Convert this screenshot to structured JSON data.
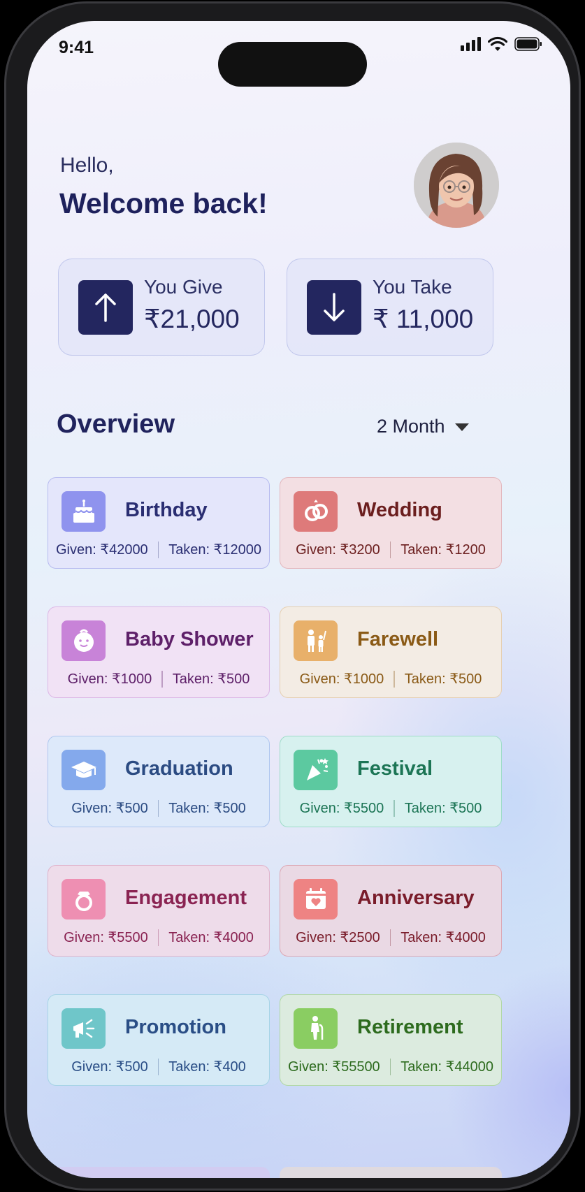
{
  "status_bar": {
    "time": "9:41"
  },
  "header": {
    "greeting": "Hello,",
    "title": "Welcome back!"
  },
  "summary": {
    "give": {
      "label": "You Give",
      "value": "₹21,000"
    },
    "take": {
      "label": "You Take",
      "value": "₹ 11,000"
    }
  },
  "overview": {
    "title": "Overview",
    "period": "2 Month"
  },
  "events": [
    {
      "name": "Birthday",
      "given": "Given: ₹42000",
      "taken": "Taken: ₹12000",
      "icon": "cake-icon",
      "accent": "#8f93ee",
      "text_color": "#2a2e72",
      "bg": "#e4e6fb",
      "border": "#b7bbef"
    },
    {
      "name": "Wedding",
      "given": "Given: ₹3200",
      "taken": "Taken: ₹1200",
      "icon": "rings-icon",
      "accent": "#de7a7a",
      "text_color": "#6b1e1e",
      "bg": "#f3dfe3",
      "border": "#e3b7bd"
    },
    {
      "name": "Baby Shower",
      "given": "Given: ₹1000",
      "taken": "Taken: ₹500",
      "icon": "baby-icon",
      "accent": "#c883d8",
      "text_color": "#5e2069",
      "bg": "#f1e2f5",
      "border": "#dcb7e6"
    },
    {
      "name": "Farewell",
      "given": "Given: ₹1000",
      "taken": "Taken: ₹500",
      "icon": "farewell-icon",
      "accent": "#e8b06a",
      "text_color": "#8a5a16",
      "bg": "#f3ece4",
      "border": "#e6cfb1"
    },
    {
      "name": "Graduation",
      "given": "Given: ₹500",
      "taken": "Taken: ₹500",
      "icon": "graduation-cap-icon",
      "accent": "#84a9ec",
      "text_color": "#2b4b82",
      "bg": "#dde9fa",
      "border": "#afc7ef"
    },
    {
      "name": "Festival",
      "given": "Given: ₹5500",
      "taken": "Taken: ₹500",
      "icon": "party-popper-icon",
      "accent": "#5cc9a0",
      "text_color": "#1c7555",
      "bg": "#d7f1ef",
      "border": "#9fdcc9"
    },
    {
      "name": "Engagement",
      "given": "Given: ₹5500",
      "taken": "Taken: ₹4000",
      "icon": "ring-icon",
      "accent": "#ee8fb2",
      "text_color": "#8a2352",
      "bg": "#eedcea",
      "border": "#e0b3cb"
    },
    {
      "name": "Anniversary",
      "given": "Given: ₹2500",
      "taken": "Taken: ₹4000",
      "icon": "calendar-heart-icon",
      "accent": "#ee8383",
      "text_color": "#7a1c2a",
      "bg": "#ead9e4",
      "border": "#dca7b4"
    },
    {
      "name": "Promotion",
      "given": "Given: ₹500",
      "taken": "Taken: ₹400",
      "icon": "megaphone-icon",
      "accent": "#6fc6c9",
      "text_color": "#2a4e86",
      "bg": "#d5eaf6",
      "border": "#a6d4e6"
    },
    {
      "name": "Retirement",
      "given": "Given: ₹55500",
      "taken": "Taken: ₹44000",
      "icon": "elderly-person-icon",
      "accent": "#8acd62",
      "text_color": "#2d6b1e",
      "bg": "#dcebdf",
      "border": "#b1d8a4"
    }
  ]
}
